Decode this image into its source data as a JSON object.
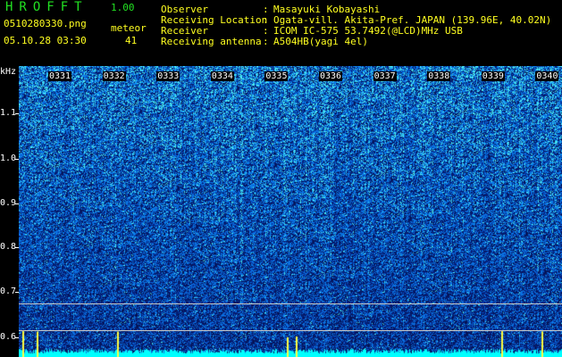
{
  "header": {
    "app_title": "HROFFT",
    "version": "1.00",
    "filename": "0510280330.png",
    "meteor_label": "meteor",
    "datetime": "05.10.28 03:30",
    "meteor_count": "41",
    "meta": [
      {
        "label": "Observer",
        "value": "Masayuki Kobayashi"
      },
      {
        "label": "Receiving Location",
        "value": "Ogata-vill. Akita-Pref. JAPAN (139.96E, 40.02N)"
      },
      {
        "label": "Receiver",
        "value": "ICOM IC-575 53.7492(@LCD)MHz USB"
      },
      {
        "label": "Receiving antenna",
        "value": "A504HB(yagi 4el)"
      }
    ],
    "separator": ":"
  },
  "axes": {
    "y_unit": "kHz",
    "y_ticks": [
      "1.1",
      "1.0",
      "0.9",
      "0.8",
      "0.7",
      "0.6"
    ],
    "x_ticks": [
      "0331",
      "0332",
      "0333",
      "0334",
      "0335",
      "0336",
      "0337",
      "0338",
      "0339",
      "0340"
    ]
  },
  "colors": {
    "background": "#000000",
    "header_green": "#22e022",
    "header_yellow": "#ffff20",
    "spectrum_low": "#0a1a6e",
    "spectrum_high": "#40ffd0",
    "bottom_trace": "#00ffff"
  }
}
